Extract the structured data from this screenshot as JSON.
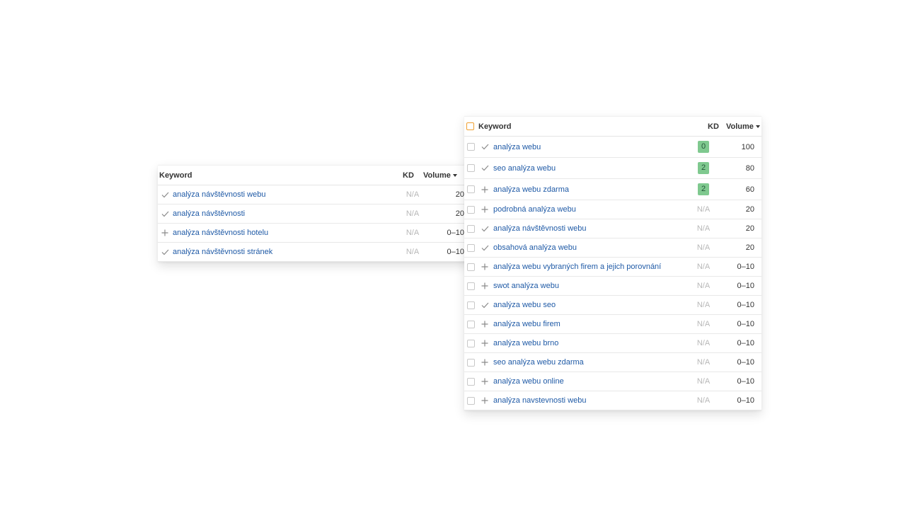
{
  "left_table": {
    "header": {
      "keyword": "Keyword",
      "kd": "KD",
      "volume": "Volume"
    },
    "rows": [
      {
        "status": "check",
        "keyword": "analýza návštěvnosti webu",
        "kd": "N/A",
        "volume": "20"
      },
      {
        "status": "check",
        "keyword": "analýza návštěvnosti",
        "kd": "N/A",
        "volume": "20"
      },
      {
        "status": "plus",
        "keyword": "analýza návštěvnosti hotelu",
        "kd": "N/A",
        "volume": "0–10"
      },
      {
        "status": "check",
        "keyword": "analýza návštěvnosti stránek",
        "kd": "N/A",
        "volume": "0–10"
      }
    ]
  },
  "right_table": {
    "header": {
      "keyword": "Keyword",
      "kd": "KD",
      "volume": "Volume"
    },
    "rows": [
      {
        "status": "check",
        "keyword": "analýza webu",
        "kd": "0",
        "volume": "100"
      },
      {
        "status": "check",
        "keyword": "seo analýza webu",
        "kd": "2",
        "volume": "80"
      },
      {
        "status": "plus",
        "keyword": "analýza webu zdarma",
        "kd": "2",
        "volume": "60"
      },
      {
        "status": "plus",
        "keyword": "podrobná analýza webu",
        "kd": "N/A",
        "volume": "20"
      },
      {
        "status": "check",
        "keyword": "analýza návštěvnosti webu",
        "kd": "N/A",
        "volume": "20"
      },
      {
        "status": "check",
        "keyword": "obsahová analýza webu",
        "kd": "N/A",
        "volume": "20"
      },
      {
        "status": "plus",
        "keyword": "analýza webu vybraných firem a jejich porovnání",
        "kd": "N/A",
        "volume": "0–10"
      },
      {
        "status": "plus",
        "keyword": "swot analýza webu",
        "kd": "N/A",
        "volume": "0–10"
      },
      {
        "status": "check",
        "keyword": "analýza webu seo",
        "kd": "N/A",
        "volume": "0–10"
      },
      {
        "status": "plus",
        "keyword": "analýza webu firem",
        "kd": "N/A",
        "volume": "0–10"
      },
      {
        "status": "plus",
        "keyword": "analýza webu brno",
        "kd": "N/A",
        "volume": "0–10"
      },
      {
        "status": "plus",
        "keyword": "seo analýza webu zdarma",
        "kd": "N/A",
        "volume": "0–10"
      },
      {
        "status": "plus",
        "keyword": "analýza webu online",
        "kd": "N/A",
        "volume": "0–10"
      },
      {
        "status": "plus",
        "keyword": "analýza navstevnosti webu",
        "kd": "N/A",
        "volume": "0–10"
      }
    ]
  },
  "colors": {
    "link": "#1f5aa6",
    "kd_badge": "#7fc98f",
    "header_checkbox": "#f0a030",
    "muted": "#b8b8b8"
  }
}
